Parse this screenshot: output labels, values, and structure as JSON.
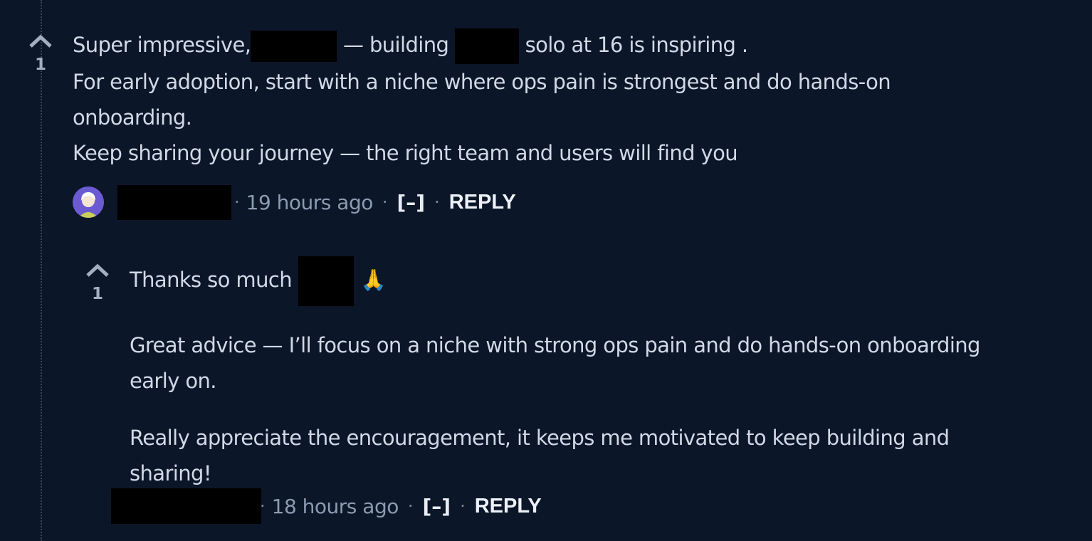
{
  "comment1": {
    "vote_count": "1",
    "line1_pre": "Super impressive,",
    "line1_mid": " — building ",
    "line1_post": " solo at 16 is inspiring .",
    "line2": "For early adoption, start with a niche where ops pain is strongest and do hands-on",
    "line3": "onboarding.",
    "line4": "Keep sharing your journey — the right team and users will find you",
    "time": "19 hours ago",
    "collapse_label": "[–]",
    "reply_label": "REPLY",
    "avatar_icon": "user-avatar-icon"
  },
  "comment2": {
    "vote_count": "1",
    "line1_pre": "Thanks so much ",
    "emoji": "🙏",
    "para1_line1": "Great advice — I’ll focus on a niche with strong ops pain and do hands-on onboarding",
    "para1_line2": "early on.",
    "para2_line1": "Really appreciate the encouragement, it keeps me motivated to keep building and",
    "para2_line2": "sharing!",
    "time": "18 hours ago",
    "collapse_label": "[–]",
    "reply_label": "REPLY"
  },
  "colors": {
    "background": "#0b1628",
    "text": "#d1d9e6",
    "muted": "#8c9bb2",
    "avatar_bg": "#6b5bd2"
  }
}
